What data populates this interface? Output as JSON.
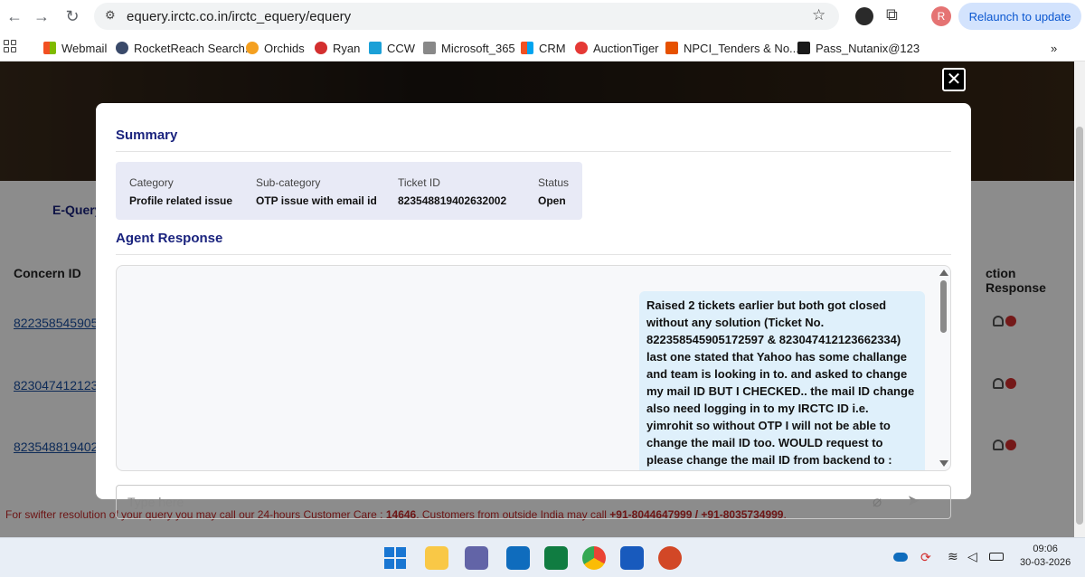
{
  "browser": {
    "url": "equery.irctc.co.in/irctc_equery/equery",
    "profile_initial": "R",
    "relaunch_label": "Relaunch to update",
    "bookmarks": [
      {
        "label": "Webmail",
        "icon": "microsoft-icon"
      },
      {
        "label": "RocketReach Search...",
        "icon": "rocketreach-icon"
      },
      {
        "label": "Orchids",
        "icon": "orchids-icon"
      },
      {
        "label": "Ryan",
        "icon": "ryan-icon"
      },
      {
        "label": "CCW",
        "icon": "cisco-icon"
      },
      {
        "label": "Microsoft_365",
        "icon": "microsoft365-icon"
      },
      {
        "label": "CRM",
        "icon": "microsoft-icon"
      },
      {
        "label": "AuctionTiger",
        "icon": "auctiontiger-icon"
      },
      {
        "label": "NPCI_Tenders & No...",
        "icon": "npci-icon"
      },
      {
        "label": "Pass_Nutanix@123",
        "icon": "nutanix-icon"
      }
    ],
    "more_bookmarks": "»"
  },
  "page": {
    "tab_label": "E-Query",
    "columns": {
      "concern_id": "Concern ID",
      "action_response": "ction Response"
    },
    "rows": [
      {
        "concern_id": "822358545905"
      },
      {
        "concern_id": "823047412123"
      },
      {
        "concern_id": "823548819402"
      }
    ],
    "footer": {
      "prefix": "For swifter resolution of your query you may call our 24-hours Customer Care : ",
      "care_number": "14646",
      "middle": ". Customers from outside India may call ",
      "intl_numbers": "+91-8044647999 / +91-8035734999",
      "suffix": "."
    }
  },
  "modal": {
    "summary_title": "Summary",
    "summary": {
      "category_label": "Category",
      "category_value": "Profile related issue",
      "subcategory_label": "Sub-category",
      "subcategory_value": "OTP issue with email id",
      "ticket_label": "Ticket ID",
      "ticket_value": "823548819402632002",
      "status_label": "Status",
      "status_value": "Open"
    },
    "agent_title": "Agent Response",
    "message": "Raised 2 tickets earlier but both got closed without any solution (Ticket No. 822358545905172597 & 823047412123662334) last one stated that Yahoo has some challange and team is looking in to. and asked to change my mail ID BUT I CHECKED.. the mail ID change also need logging in to my IRCTC ID i.e. yimrohit so without OTP I will not be able to change the mail ID too. WOULD request to please change the mail ID from backend to : yimrohit@gmail.com Due to this concern I have not",
    "input_placeholder": "Type here",
    "close_glyph": "✕"
  },
  "taskbar": {
    "time": "09:06",
    "date": "30-03-2026"
  },
  "colors": {
    "accent_navy": "#1a237e",
    "summary_bg": "#e8eaf6",
    "bubble_bg": "#dff0fb",
    "footer_red": "#c62828"
  }
}
